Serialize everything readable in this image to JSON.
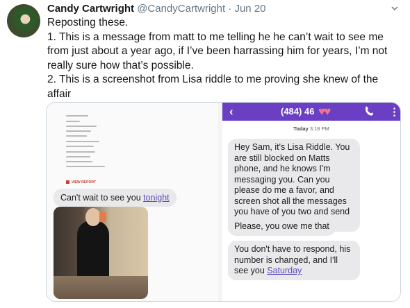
{
  "tweet": {
    "display_name": "Candy Cartwright",
    "handle": "@CandyCartwright",
    "separator": "·",
    "date": "Jun 20",
    "paragraphs": [
      "Reposting these.",
      "1. This is a message from matt to me telling he he can’t wait to see me from just about a year ago, if I’ve been harrassing him for years, I’m not really sure how that’s possible.",
      "2. This is a screenshot from Lisa riddle to me proving she knew of the affair"
    ]
  },
  "left_screenshot": {
    "view_report": "VIEW REPORT",
    "bubble_text": "Can't wait to see you ",
    "bubble_link": "tonight"
  },
  "right_screenshot": {
    "back": "‹",
    "phone_number": "(484) 46",
    "more": "⋮",
    "date_day": "Today",
    "date_time": "3:18 PM",
    "msg1": "Hey Sam, it's Lisa Riddle. You are still blocked on Matts phone, and he knows I'm messaging you. Can you please do me a favor, and screen shot all the messages you have of you two and send them to me?",
    "msg2": "Please, you owe me that",
    "msg3": "You don't have to respond, his number is changed, and I'll see you ",
    "msg3_link": "Saturday"
  },
  "colors": {
    "accent_purple": "#6a3fc4",
    "link_purple": "#5e4bb8",
    "bubble_gray": "#e9e9eb"
  },
  "icons": [
    "avatar-photo",
    "caret-down-icon",
    "back-chevron-icon",
    "heart-emoji",
    "call-icon",
    "more-vertical-icon"
  ]
}
